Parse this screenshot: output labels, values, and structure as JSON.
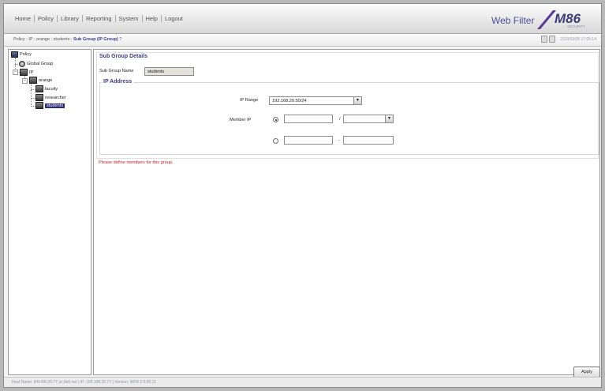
{
  "menu": {
    "items": [
      "Home",
      "Policy",
      "Library",
      "Reporting",
      "System",
      "Help",
      "Logout"
    ]
  },
  "product": "Web Filter",
  "logo": {
    "text": "M86",
    "sub": "SECURITY"
  },
  "breadcrumb": {
    "path": "Policy : IP : orange : students : ",
    "current": "Sub Group (IP Group)",
    "help": "?"
  },
  "timestamp": "2010/03/05 17:05:14",
  "tree": {
    "root": "Policy",
    "global": "Global Group",
    "ip": "IP",
    "orange": "orange",
    "faculty": "faculty",
    "researcher": "researcher",
    "students": "students"
  },
  "details": {
    "title": "Sub Group Details",
    "name_label": "Sub Group Name",
    "name_value": "students"
  },
  "ip": {
    "title": "IP Address",
    "range_label": "IP Range",
    "range_value": "192.168.20.50/24",
    "member_label": "Member IP",
    "slash": "/",
    "dash": "-"
  },
  "warning": "Please define members for this group.",
  "apply_label": "Apply",
  "status": "Host Name: iFR-R6-20-77.sc.8e6.net  |  IP: 192.168.20.77  |  Version: WFR 2.0.00.11"
}
